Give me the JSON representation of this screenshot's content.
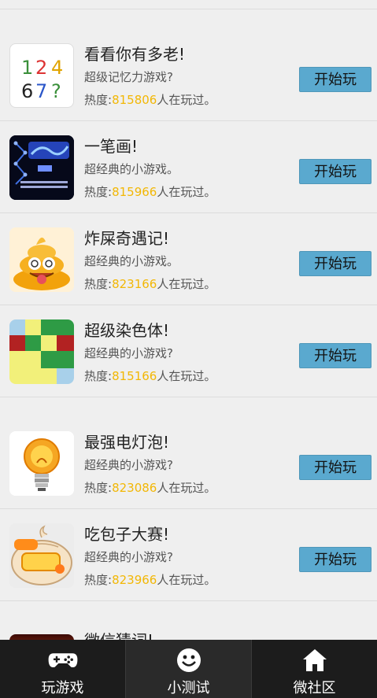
{
  "games": [
    {
      "icon": "digits-1247-icon",
      "title": "看看你有多老!",
      "desc": "超级记忆力游戏?",
      "heat_prefix": "热度:",
      "heat_num": "815806",
      "heat_suffix": "人在玩过。",
      "button": "开始玩",
      "icon_text": [
        "1",
        "2",
        "4",
        "6",
        "7",
        "?"
      ]
    },
    {
      "icon": "one-stroke-icon",
      "title": "一笔画!",
      "desc": "超经典的小游戏。",
      "heat_prefix": "热度:",
      "heat_num": "815966",
      "heat_suffix": "人在玩过。",
      "button": "开始玩"
    },
    {
      "icon": "poop-face-icon",
      "title": "炸屎奇遇记!",
      "desc": "超经典的小游戏。",
      "heat_prefix": "热度:",
      "heat_num": "823166",
      "heat_suffix": "人在玩过。",
      "button": "开始玩"
    },
    {
      "icon": "color-grid-icon",
      "title": "超级染色体!",
      "desc": "超经典的小游戏?",
      "heat_prefix": "热度:",
      "heat_num": "815166",
      "heat_suffix": "人在玩过。",
      "button": "开始玩"
    },
    {
      "icon": "light-bulb-icon",
      "title": "最强电灯泡!",
      "desc": "超经典的小游戏?",
      "heat_prefix": "热度:",
      "heat_num": "823086",
      "heat_suffix": "人在玩过。",
      "button": "开始玩"
    },
    {
      "icon": "steamed-bun-icon",
      "title": "吃包子大赛!",
      "desc": "超经典的小游戏?",
      "heat_prefix": "热度:",
      "heat_num": "823966",
      "heat_suffix": "人在玩过。",
      "button": "开始玩"
    }
  ],
  "peek_title": "微信猜词!",
  "tabs": [
    {
      "icon": "gamepad-icon",
      "label": "玩游戏"
    },
    {
      "icon": "smiley-icon",
      "label": "小测试"
    },
    {
      "icon": "house-icon",
      "label": "微社区"
    }
  ],
  "colors": {
    "accent": "#5aa9cf",
    "heat": "#f2b705",
    "tabbar": "#1c1c1c"
  }
}
